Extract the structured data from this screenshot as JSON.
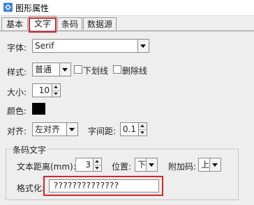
{
  "window": {
    "title": "图形属性",
    "icon": "diamond-app-icon"
  },
  "tabs": [
    {
      "label": "基本"
    },
    {
      "label": "文字"
    },
    {
      "label": "条码"
    },
    {
      "label": "数据源"
    }
  ],
  "active_tab": "文字",
  "font": {
    "label": "字体:",
    "value": "Serif"
  },
  "style": {
    "label": "样式:",
    "value": "普通",
    "underline_label": "下划线",
    "underline_checked": false,
    "strike_label": "删除线",
    "strike_checked": false
  },
  "size": {
    "label": "大小:",
    "value": "10"
  },
  "color": {
    "label": "颜色:",
    "value": "#000000"
  },
  "align": {
    "label": "对齐:",
    "value": "左对齐",
    "spacing_label": "字间距:",
    "spacing_value": "0.1"
  },
  "barcode_text": {
    "group_label": "条码文字",
    "distance_label": "文本距离(mm):",
    "distance_value": "3",
    "position_label": "位置:",
    "position_value": "下",
    "addon_label": "附加码:",
    "addon_value": "上",
    "format_label": "格式化:",
    "format_value": "??????????????"
  },
  "highlight_color": "#d9232a"
}
